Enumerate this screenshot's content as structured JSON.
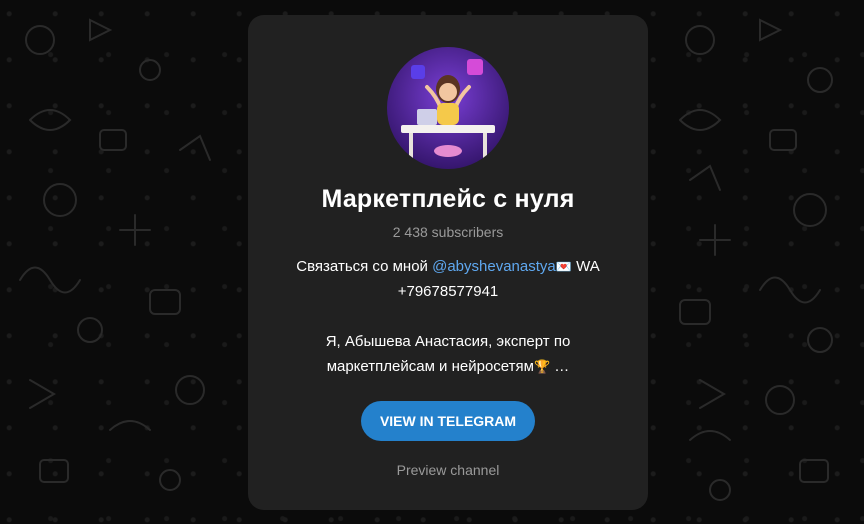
{
  "channel": {
    "title": "Маркетплейс с нуля",
    "subscribers": "2 438 subscribers",
    "avatar_icon": "channel-avatar-icon"
  },
  "description": {
    "line1_prefix": "Связаться со мной ",
    "mention": "@abyshevanastya",
    "mail_emoji": "💌",
    "line1_suffix": " WA",
    "phone": "+79678577941",
    "line3": "Я, Абышева Анастасия, эксперт по",
    "line4_text": "маркетплейсам и нейросетям",
    "trophy_emoji": "🏆",
    "ellipsis": "…"
  },
  "actions": {
    "view_button": "VIEW IN TELEGRAM",
    "preview_link": "Preview channel"
  },
  "colors": {
    "accent": "#2481cc",
    "mention": "#5fa8f0",
    "card": "#212121",
    "background": "#0b0b0b"
  }
}
